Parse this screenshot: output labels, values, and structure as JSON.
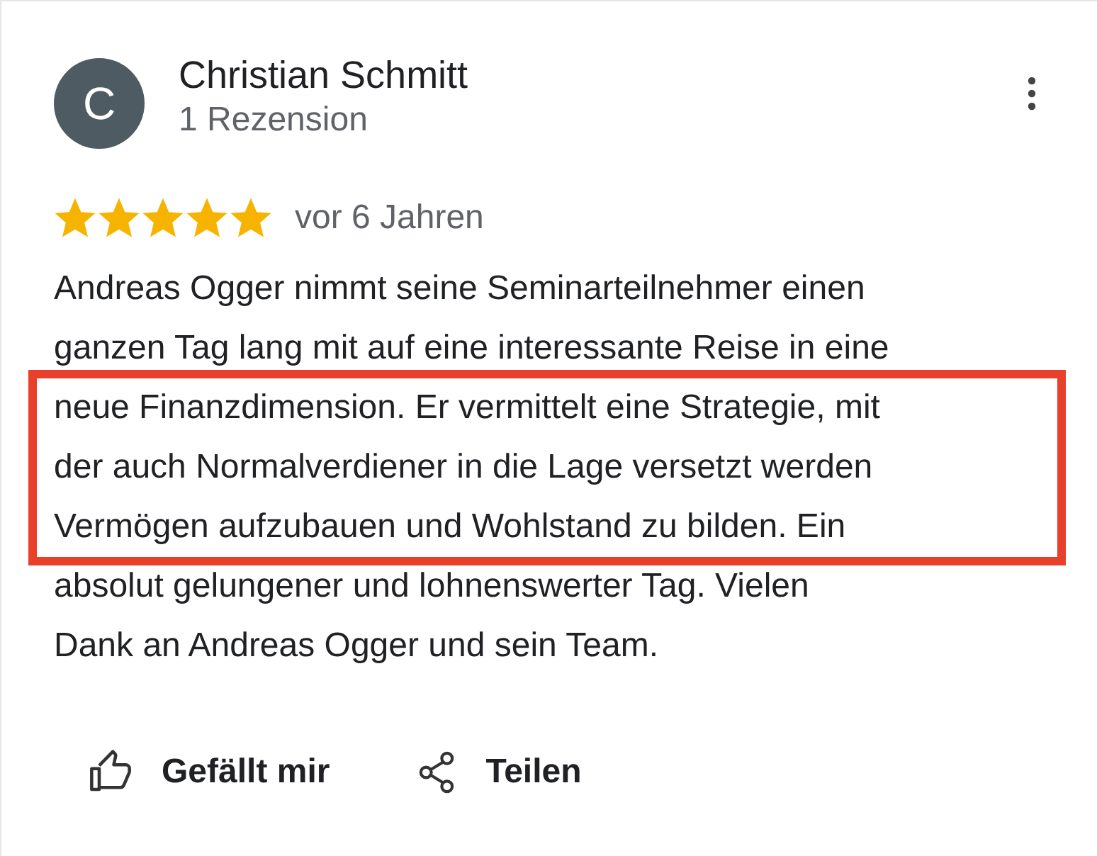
{
  "reviewer": {
    "initial": "C",
    "name": "Christian Schmitt",
    "review_count": "1 Rezension"
  },
  "review": {
    "stars": 5,
    "time": "vor 6 Jahren",
    "lines": [
      {
        "text": "Andreas Ogger nimmt seine Seminarteilnehmer einen",
        "highlighted": false
      },
      {
        "text": "ganzen Tag lang mit auf eine interessante Reise in eine",
        "highlighted": false
      },
      {
        "text": "neue Finanzdimension. Er vermittelt eine Strategie, mit",
        "highlighted": true
      },
      {
        "text": "der auch Normalverdiener in die Lage versetzt werden",
        "highlighted": true
      },
      {
        "text": "Vermögen aufzubauen und Wohlstand zu bilden. Ein",
        "highlighted": true
      },
      {
        "text": "absolut gelungener und lohnenswerter Tag. Vielen",
        "highlighted": false
      },
      {
        "text": "Dank an Andreas Ogger und sein Team.",
        "highlighted": false
      }
    ]
  },
  "actions": [
    {
      "kind": "like",
      "label": "Gefällt mir"
    },
    {
      "kind": "share",
      "label": "Teilen"
    }
  ]
}
